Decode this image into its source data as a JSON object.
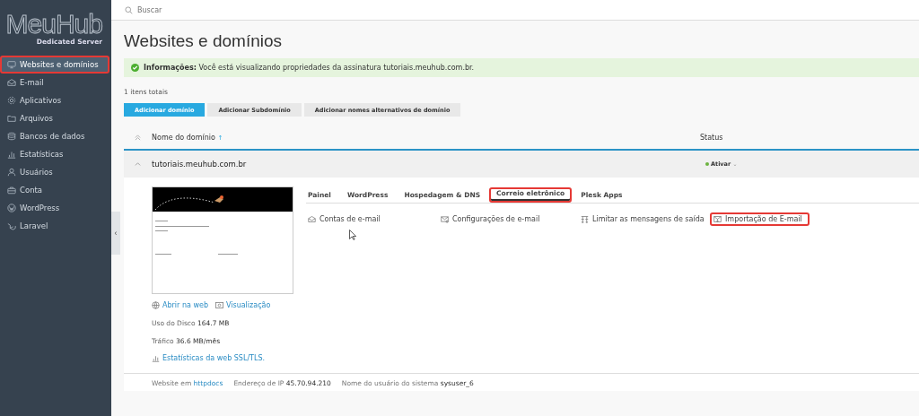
{
  "logo": {
    "name": "MeuHub",
    "tagline": "Dedicated Server"
  },
  "sidebar": {
    "items": [
      {
        "label": "Websites e domínios",
        "selected": true,
        "highlighted": true
      },
      {
        "label": "E-mail",
        "selected": false,
        "highlighted": false
      },
      {
        "label": "Aplicativos",
        "selected": false,
        "highlighted": false
      },
      {
        "label": "Arquivos",
        "selected": false,
        "highlighted": false
      },
      {
        "label": "Bancos de dados",
        "selected": false,
        "highlighted": false
      },
      {
        "label": "Estatísticas",
        "selected": false,
        "highlighted": false
      },
      {
        "label": "Usuários",
        "selected": false,
        "highlighted": false
      },
      {
        "label": "Conta",
        "selected": false,
        "highlighted": false
      },
      {
        "label": "WordPress",
        "selected": false,
        "highlighted": false
      },
      {
        "label": "Laravel",
        "selected": false,
        "highlighted": false
      }
    ],
    "collapse_glyph": "‹"
  },
  "search": {
    "placeholder": "Buscar"
  },
  "page_title": "Websites e domínios",
  "info": {
    "label": "Informações:",
    "text": "Você está visualizando propriedades da assinatura tutoriais.meuhub.com.br."
  },
  "total": "1 itens totais",
  "buttons": [
    {
      "label": "Adicionar domínio",
      "primary": true
    },
    {
      "label": "Adicionar Subdomínio",
      "primary": false
    },
    {
      "label": "Adicionar nomes alternativos de domínio",
      "primary": false
    }
  ],
  "table": {
    "columns": [
      "Nome do domínio",
      "Status"
    ],
    "sort_glyph": "↑",
    "row": {
      "domain": "tutoriais.meuhub.com.br",
      "expanded": true,
      "status": "Ativar",
      "dropdown_glyph": "⌄"
    }
  },
  "tabs": [
    {
      "label": "Painel",
      "selected": false,
      "highlighted": false
    },
    {
      "label": "WordPress",
      "selected": false,
      "highlighted": false
    },
    {
      "label": "Hospedagem & DNS",
      "selected": false,
      "highlighted": false
    },
    {
      "label": "Correio eletrônico",
      "selected": true,
      "highlighted": true
    },
    {
      "label": "Plesk Apps",
      "selected": false,
      "highlighted": false
    }
  ],
  "actions": [
    {
      "label": "Contas de e-mail",
      "highlighted": false
    },
    {
      "label": "Configurações de e-mail",
      "highlighted": false
    },
    {
      "label": "Limitar as mensagens de saída",
      "highlighted": false
    },
    {
      "label": "Importação de E-mail",
      "highlighted": true
    }
  ],
  "preview_links": [
    {
      "label": "Abrir na web"
    },
    {
      "label": "Visualização"
    }
  ],
  "stats": [
    {
      "label": "Uso do Disco",
      "value": "164.7 MB"
    },
    {
      "label": "Tráfico",
      "value": "36.6 MB/mês"
    }
  ],
  "stats_link": "Estatísticas da web SSL/TLS.",
  "footer": [
    {
      "label": "Website em",
      "value": "httpdocs",
      "link": true
    },
    {
      "label": "Endereço de IP",
      "value": "45.70.94.210",
      "link": false
    },
    {
      "label": "Nome do usuário do sistema",
      "value": "sysuser_6",
      "link": false
    }
  ]
}
